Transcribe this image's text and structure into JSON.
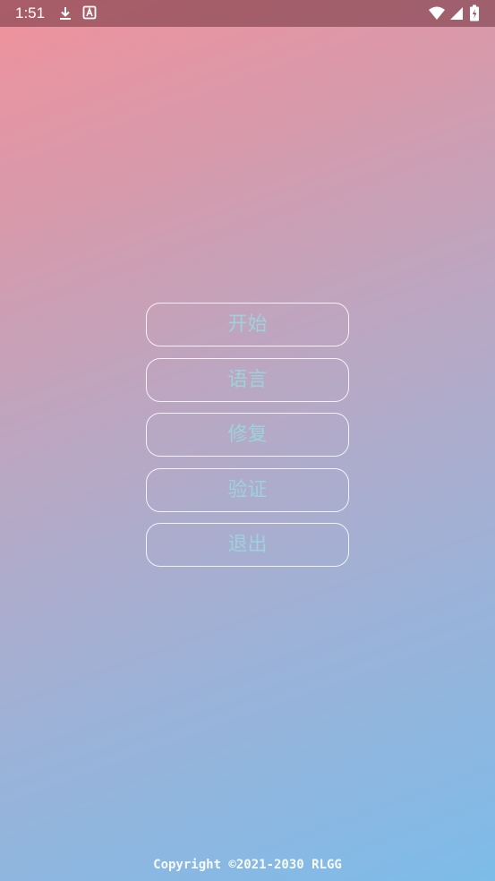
{
  "status_bar": {
    "time": "1:51",
    "icons": [
      "download-icon",
      "a-badge-icon",
      "wifi-icon",
      "signal-icon",
      "battery-icon"
    ]
  },
  "menu": {
    "buttons": [
      {
        "label": "开始"
      },
      {
        "label": "语言"
      },
      {
        "label": "修复"
      },
      {
        "label": "验证"
      },
      {
        "label": "退出"
      }
    ]
  },
  "footer": {
    "copyright": "Copyright ©2021-2030 RLGG"
  },
  "colors": {
    "gradient_start": "#f0929c",
    "gradient_end": "#7dbce9",
    "button_text": "#9dd2dc",
    "button_border": "#ffffff"
  }
}
